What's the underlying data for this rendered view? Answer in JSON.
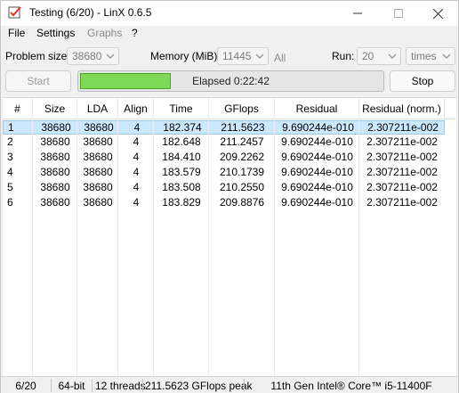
{
  "window": {
    "title": "Testing (6/20) - LinX 0.6.5"
  },
  "menu": {
    "file": "File",
    "settings": "Settings",
    "graphs": "Graphs",
    "help": "?"
  },
  "params": {
    "problem_size_label": "Problem size:",
    "problem_size_value": "38680",
    "memory_label": "Memory (MiB):",
    "memory_value": "11445",
    "all_label": "All",
    "run_label": "Run:",
    "run_value": "20",
    "times_value": "times"
  },
  "controls": {
    "start_label": "Start",
    "stop_label": "Stop",
    "elapsed_text": "Elapsed 0:22:42",
    "progress_fraction": 0.3,
    "progress_color": "#7ed957"
  },
  "table": {
    "columns": [
      "#",
      "Size",
      "LDA",
      "Align",
      "Time",
      "GFlops",
      "Residual",
      "Residual (norm.)"
    ],
    "rows": [
      [
        "1",
        "38680",
        "38680",
        "4",
        "182.374",
        "211.5623",
        "9.690244e-010",
        "2.307211e-002"
      ],
      [
        "2",
        "38680",
        "38680",
        "4",
        "182.648",
        "211.2457",
        "9.690244e-010",
        "2.307211e-002"
      ],
      [
        "3",
        "38680",
        "38680",
        "4",
        "184.410",
        "209.2262",
        "9.690244e-010",
        "2.307211e-002"
      ],
      [
        "4",
        "38680",
        "38680",
        "4",
        "183.579",
        "210.1739",
        "9.690244e-010",
        "2.307211e-002"
      ],
      [
        "5",
        "38680",
        "38680",
        "4",
        "183.508",
        "210.2550",
        "9.690244e-010",
        "2.307211e-002"
      ],
      [
        "6",
        "38680",
        "38680",
        "4",
        "183.829",
        "209.8876",
        "9.690244e-010",
        "2.307211e-002"
      ]
    ],
    "selected_row": 0
  },
  "status": {
    "progress": "6/20",
    "bits": "64-bit",
    "threads": "12 threads",
    "peak": "211.5623 GFlops peak",
    "cpu": "11th Gen Intel® Core™ i5-11400F"
  }
}
